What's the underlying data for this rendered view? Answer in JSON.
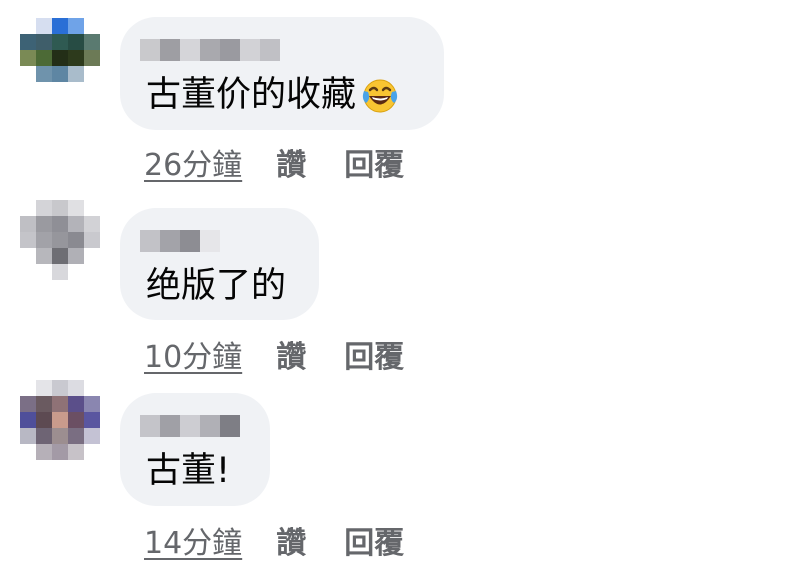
{
  "comments": [
    {
      "text": "古董价的收藏",
      "emoji": "tears-of-joy-emoji",
      "time": "26分鐘",
      "like": "讚",
      "reply": "回覆"
    },
    {
      "text": "绝版了的",
      "time": "10分鐘",
      "like": "讚",
      "reply": "回覆"
    },
    {
      "text": "古董!",
      "time": "14分鐘",
      "like": "讚",
      "reply": "回覆"
    }
  ],
  "colors": {
    "bubble": "#f0f2f5",
    "text": "#050505",
    "meta": "#65676b"
  }
}
